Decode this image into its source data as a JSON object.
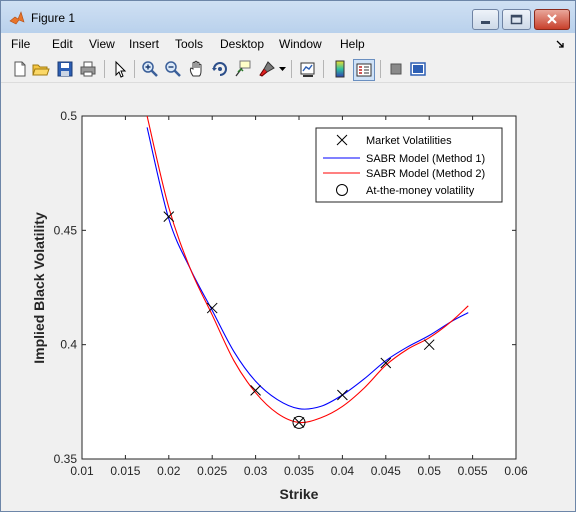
{
  "window": {
    "title": "Figure 1"
  },
  "menu": [
    "File",
    "Edit",
    "View",
    "Insert",
    "Tools",
    "Desktop",
    "Window",
    "Help"
  ],
  "toolbar_icons": [
    "new-figure-icon",
    "open-file-icon",
    "save-icon",
    "print-icon",
    "pointer-icon",
    "zoom-in-icon",
    "zoom-out-icon",
    "pan-icon",
    "rotate-3d-icon",
    "data-cursor-icon",
    "brush-icon",
    "brush-dropdown-icon",
    "link-plot-icon",
    "colorbar-icon",
    "legend-icon",
    "hide-plot-tools-icon",
    "show-plot-tools-icon"
  ],
  "chart_data": {
    "type": "line",
    "xlabel": "Strike",
    "ylabel": "Implied Black Volatility",
    "xlim": [
      0.01,
      0.06
    ],
    "ylim": [
      0.35,
      0.5
    ],
    "xticks": [
      "0.01",
      "0.015",
      "0.02",
      "0.025",
      "0.03",
      "0.035",
      "0.04",
      "0.045",
      "0.05",
      "0.055",
      "0.06"
    ],
    "yticks": [
      "0.35",
      "0.4",
      "0.45",
      "0.5"
    ],
    "legend_position": "top-right",
    "series": [
      {
        "name": "Market Volatilities",
        "kind": "marker-x",
        "color": "#000000",
        "x": [
          0.02,
          0.025,
          0.03,
          0.035,
          0.04,
          0.045,
          0.05
        ],
        "y": [
          0.456,
          0.416,
          0.38,
          0.366,
          0.378,
          0.392,
          0.4
        ]
      },
      {
        "name": "SABR Model (Method 1)",
        "kind": "line",
        "color": "#0000ff",
        "x": [
          0.0175,
          0.02,
          0.0225,
          0.025,
          0.0275,
          0.03,
          0.0325,
          0.035,
          0.0375,
          0.04,
          0.0425,
          0.045,
          0.0475,
          0.05,
          0.0525,
          0.0545
        ],
        "y": [
          0.495,
          0.455,
          0.433,
          0.415,
          0.397,
          0.384,
          0.376,
          0.372,
          0.373,
          0.378,
          0.385,
          0.393,
          0.399,
          0.404,
          0.41,
          0.414
        ]
      },
      {
        "name": "SABR Model (Method 2)",
        "kind": "line",
        "color": "#ff0000",
        "x": [
          0.0175,
          0.02,
          0.0225,
          0.025,
          0.0275,
          0.03,
          0.0325,
          0.035,
          0.0375,
          0.04,
          0.0425,
          0.045,
          0.0475,
          0.05,
          0.0525,
          0.0545
        ],
        "y": [
          0.5,
          0.46,
          0.433,
          0.413,
          0.393,
          0.379,
          0.37,
          0.366,
          0.368,
          0.373,
          0.381,
          0.391,
          0.398,
          0.403,
          0.41,
          0.417
        ]
      },
      {
        "name": "At-the-money volatility",
        "kind": "marker-o",
        "color": "#000000",
        "x": [
          0.035
        ],
        "y": [
          0.366
        ]
      }
    ]
  }
}
